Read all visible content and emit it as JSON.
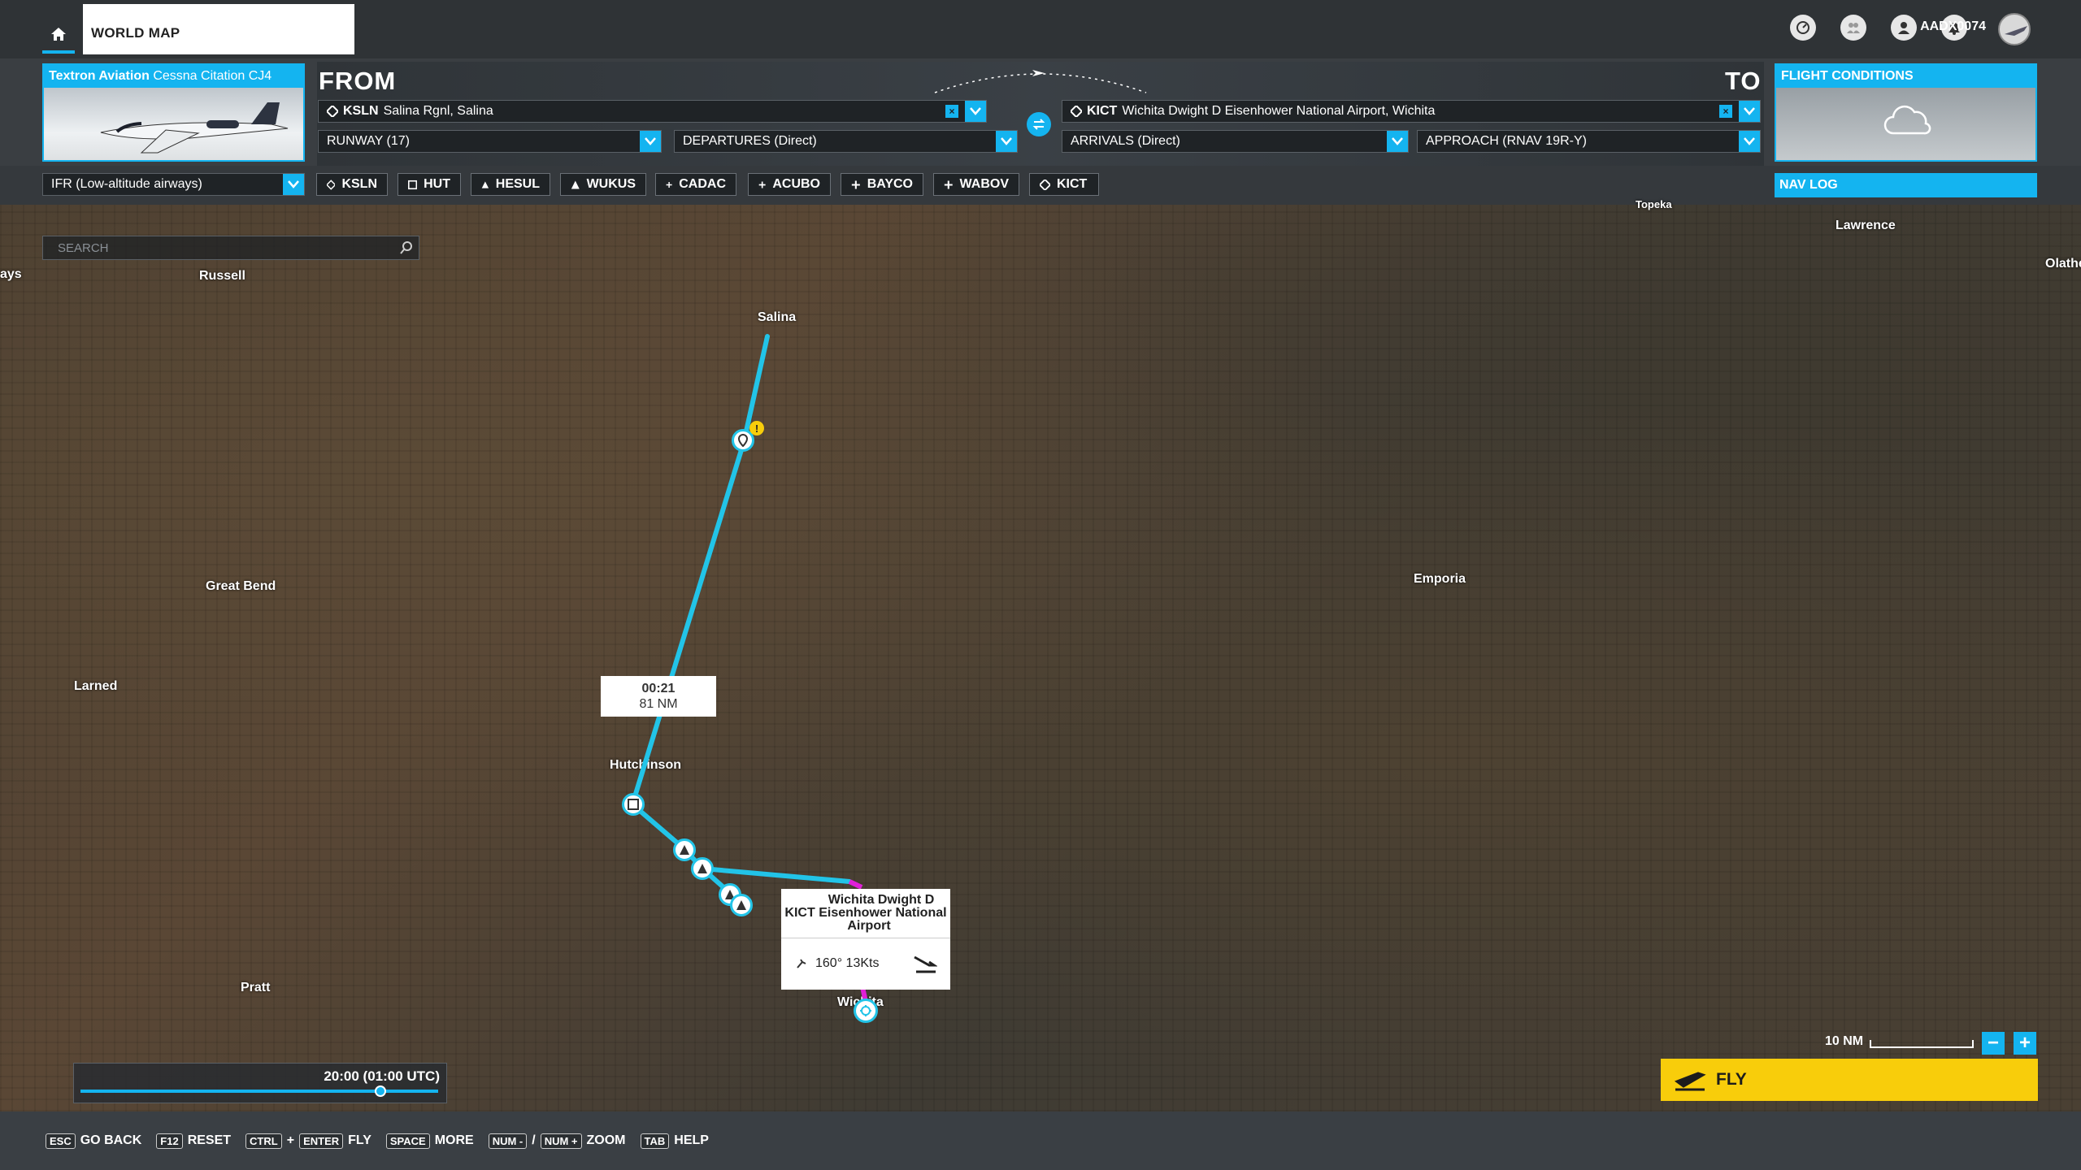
{
  "topbar": {
    "tab_title": "WORLD MAP",
    "username": "AADX0074",
    "icons": [
      "home-icon",
      "speed-icon",
      "group-icon",
      "profile-icon",
      "notification-icon"
    ]
  },
  "aircraft": {
    "brand": "Textron Aviation",
    "model": "Cessna Citation CJ4"
  },
  "from": {
    "label": "FROM",
    "airport_code": "KSLN",
    "airport_name": "Salina Rgnl, Salina",
    "runway": "RUNWAY (17)",
    "departure": "DEPARTURES (Direct)"
  },
  "to": {
    "label": "TO",
    "airport_code": "KICT",
    "airport_name": "Wichita Dwight D Eisenhower National Airport, Wichita",
    "arrival": "ARRIVALS (Direct)",
    "approach": "APPROACH (RNAV 19R-Y)"
  },
  "flight_conditions": {
    "title": "FLIGHT CONDITIONS"
  },
  "route": {
    "type": "IFR (Low-altitude airways)",
    "waypoints": [
      "KSLN",
      "HUT",
      "HESUL",
      "WUKUS",
      "CADAC",
      "ACUBO",
      "BAYCO",
      "WABOV",
      "KICT"
    ],
    "nav_log": "NAV LOG"
  },
  "map": {
    "search_placeholder": "SEARCH",
    "cities": [
      "ays",
      "Russell",
      "Salina",
      "Lawrence",
      "Olathe",
      "Great Bend",
      "Emporia",
      "Larned",
      "Hutchinson",
      "Pratt",
      "Wichita",
      "Topeka"
    ],
    "leg_time": "00:21",
    "leg_distance": "81 NM",
    "popup": {
      "code": "KICT",
      "name_line1": "Wichita Dwight D",
      "name_line2": "Eisenhower National",
      "name_line3": "Airport",
      "wind": "160° 13Kts"
    },
    "time": "20:00 (01:00 UTC)",
    "scale": "10 NM",
    "zoom_out": "−",
    "zoom_in": "+",
    "fly_label": "FLY"
  },
  "hints": [
    {
      "key": "ESC",
      "label": "GO BACK"
    },
    {
      "key": "F12",
      "label": "RESET"
    },
    {
      "key": "CTRL",
      "plus": "+",
      "key2": "ENTER",
      "label": "FLY"
    },
    {
      "key": "SPACE",
      "label": "MORE"
    },
    {
      "key": "NUM -",
      "plus": "/",
      "key2": "NUM +",
      "label": "ZOOM"
    },
    {
      "key": "TAB",
      "label": "HELP"
    }
  ]
}
